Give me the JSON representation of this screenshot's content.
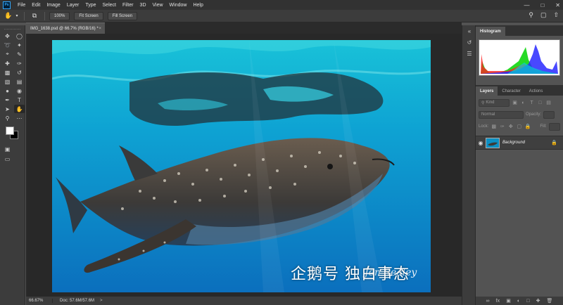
{
  "app": {
    "logo": "Ps"
  },
  "menu": [
    "File",
    "Edit",
    "Image",
    "Layer",
    "Type",
    "Select",
    "Filter",
    "3D",
    "View",
    "Window",
    "Help"
  ],
  "options_bar": {
    "zoom_value": "100%",
    "fit_screen": "Fit Screen",
    "fill_screen": "Fill Screen"
  },
  "document": {
    "tab_title": "IMG_1638.psd @ 66.7% (RGB/16) *",
    "close": "×"
  },
  "status": {
    "zoom": "66.67%",
    "doc_size": "Doc: 57.6M/57.6M",
    "arrow": ">"
  },
  "image_overlay": {
    "signature": "Jen Sealey",
    "watermark": "企鹅号 独白事态"
  },
  "panels": {
    "histogram_tab": "Histogram",
    "layers_tabs": [
      "Layers",
      "Character",
      "Actions"
    ],
    "kind_filter": "Kind",
    "blend_mode": "Normal",
    "opacity_label": "Opacity:",
    "lock_label": "Lock:",
    "fill_label": "Fill:",
    "layer_name": "Background"
  },
  "icons": {
    "move": "move-icon",
    "marquee": "marquee-icon",
    "lasso": "lasso-icon",
    "quick-select": "quick-select-icon",
    "crop": "crop-icon",
    "eyedropper": "eyedropper-icon",
    "heal": "healing-brush-icon",
    "brush": "brush-icon",
    "stamp": "clone-stamp-icon",
    "history-brush": "history-brush-icon",
    "eraser": "eraser-icon",
    "gradient": "gradient-icon",
    "blur": "blur-icon",
    "dodge": "dodge-icon",
    "pen": "pen-icon",
    "type": "type-icon",
    "path-select": "path-select-icon",
    "hand": "hand-icon",
    "zoom": "zoom-icon",
    "more": "more-tools-icon"
  },
  "colors": {
    "foreground": "#ffffff",
    "background": "#000000",
    "accent": "#31a8ff"
  }
}
